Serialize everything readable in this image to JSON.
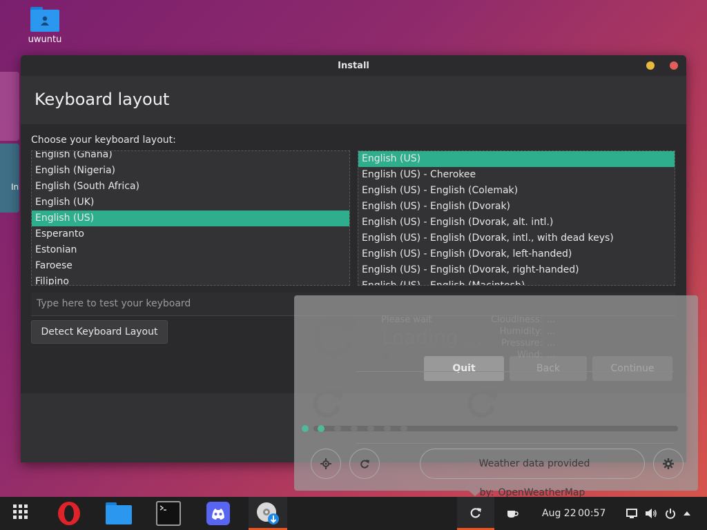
{
  "desktop": {
    "icon_label": "uwuntu",
    "side_label": "In"
  },
  "window": {
    "title": "Install",
    "header": "Keyboard layout",
    "prompt": "Choose your keyboard layout:",
    "left_list": [
      "English (Ghana)",
      "English (Nigeria)",
      "English (South Africa)",
      "English (UK)",
      "English (US)",
      "Esperanto",
      "Estonian",
      "Faroese",
      "Filipino"
    ],
    "left_selected": "English (US)",
    "right_list": [
      "English (US)",
      "English (US) - Cherokee",
      "English (US) - English (Colemak)",
      "English (US) - English (Dvorak)",
      "English (US) - English (Dvorak, alt. intl.)",
      "English (US) - English (Dvorak, intl., with dead keys)",
      "English (US) - English (Dvorak, left-handed)",
      "English (US) - English (Dvorak, right-handed)",
      "English (US) - English (Macintosh)"
    ],
    "right_selected": "English (US)",
    "test_placeholder": "Type here to test your keyboard",
    "detect_button": "Detect Keyboard Layout"
  },
  "weather": {
    "please_wait": "Please wait",
    "loading": "Loading ...",
    "cloudiness_label": "Cloudiness:",
    "cloudiness_value": "...",
    "humidity_label": "Humidity:",
    "humidity_value": "...",
    "pressure_label": "Pressure:",
    "pressure_value": "...",
    "wind_label": "Wind:",
    "wind_value": "...",
    "quit": "Quit",
    "back": "Back",
    "continue": "Continue",
    "provider_label": "Weather data provided by:",
    "provider_name": "OpenWeatherMap"
  },
  "taskbar": {
    "date": "Aug 22",
    "time": "00:57",
    "apps": [
      "app-grid-icon",
      "opera-icon",
      "files-icon",
      "terminal-icon",
      "discord-icon",
      "installer-icon"
    ]
  },
  "colors": {
    "accent": "#2eae8c",
    "active_indicator": "#e95420"
  }
}
